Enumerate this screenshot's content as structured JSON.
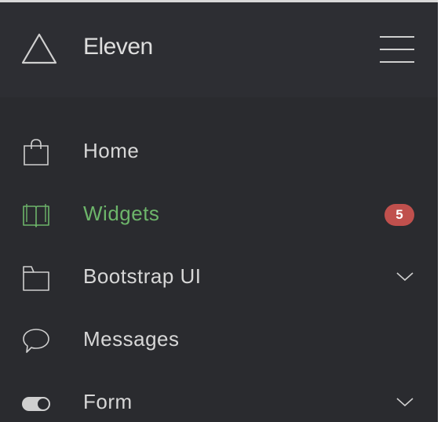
{
  "brand": {
    "name": "Eleven",
    "logo_icon": "triangle-icon"
  },
  "header": {
    "menu_icon": "hamburger-icon"
  },
  "nav": {
    "items": [
      {
        "label": "Home",
        "icon": "shopping-bag-icon",
        "active": false
      },
      {
        "label": "Widgets",
        "icon": "book-icon",
        "active": true,
        "badge": "5"
      },
      {
        "label": "Bootstrap UI",
        "icon": "folder-icon",
        "active": false,
        "has_submenu": true
      },
      {
        "label": "Messages",
        "icon": "speech-bubble-icon",
        "active": false
      },
      {
        "label": "Form",
        "icon": "toggle-icon",
        "active": false,
        "has_submenu": true
      }
    ]
  },
  "colors": {
    "sidebar_bg": "#2a2b2f",
    "header_bg": "#2d2e33",
    "text": "#d7d7d7",
    "active": "#6db56a",
    "badge_bg": "#c0504d"
  }
}
